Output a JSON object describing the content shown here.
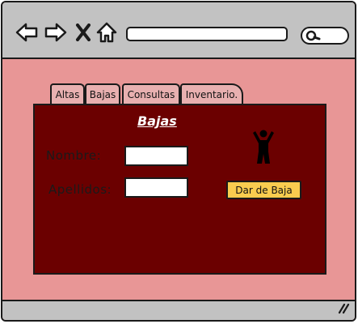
{
  "toolbar": {
    "back_icon": "arrow-left-icon",
    "forward_icon": "arrow-right-icon",
    "close_icon": "close-icon",
    "home_icon": "home-icon",
    "search_icon": "search-icon",
    "address_value": "",
    "search_value": ""
  },
  "tabs": [
    {
      "label": "Altas"
    },
    {
      "label": "Bajas"
    },
    {
      "label": "Consultas"
    },
    {
      "label": "Inventario."
    }
  ],
  "panel": {
    "title": "Bajas",
    "nombre_label": "Nombre:",
    "nombre_value": "",
    "apellidos_label": "Apellidos:",
    "apellidos_value": "",
    "person_icon": "person-icon",
    "action_label": "Dar de Baja"
  },
  "colors": {
    "chrome": "#c2c2c2",
    "page_background": "#e89696",
    "panel_background": "#6b0000",
    "button": "#f9cc4f"
  }
}
